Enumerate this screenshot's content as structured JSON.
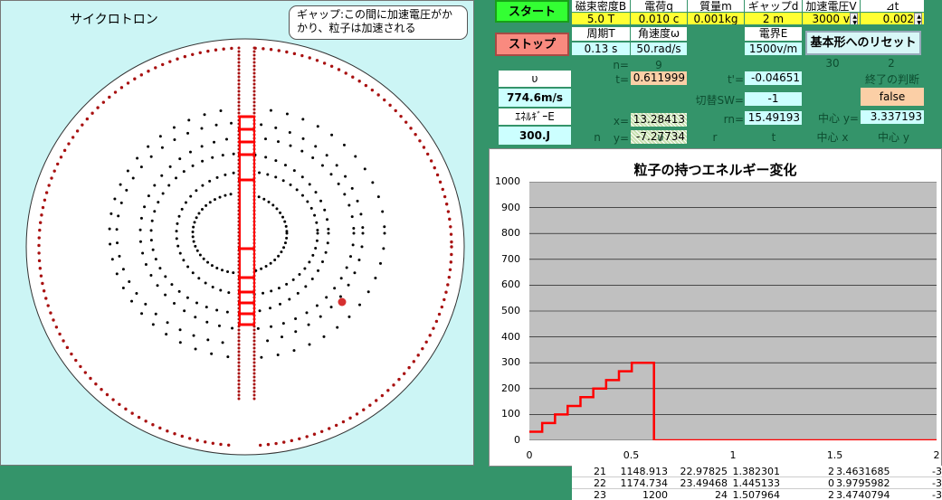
{
  "app": {
    "title": "サイクロトロン",
    "callout": "ギャップ:この間に加速電圧がかかり、粒子は加速される"
  },
  "buttons": {
    "start": "スタート",
    "stop": "ストップ",
    "reset": "基本形へのリセット"
  },
  "params": {
    "headers": [
      "磁束密度B",
      "電荷q",
      "質量m",
      "ギャップd",
      "加速電圧V",
      "⊿t"
    ],
    "values": [
      "5.0 T",
      "0.010 c",
      "0.001kg",
      "2 m",
      "3000 v",
      "0.002"
    ],
    "period_label": "周期T",
    "period_value": "0.13 s",
    "omega_label": "角速度ω",
    "omega_value": "50.rad/s",
    "efield_label": "電界E",
    "efield_value": "1500v/m",
    "extra1": "30",
    "extra2": "2"
  },
  "sim": {
    "v_label": "υ",
    "v_value": "774.6m/s",
    "e_label": "ｴﾈﾙｷﾞｰE",
    "e_value": "300.J",
    "n_label": "n=",
    "n_value": "9",
    "t_label": "t=",
    "t_value": "0.611999",
    "x_label": "x=",
    "x_value": "13.28413",
    "y_label": "y=",
    "y_value": "-7.27734",
    "tp_label": "t'=",
    "tp_value": "-0.04651",
    "sw_label": "切替SW=",
    "sw_value": "-1",
    "rn_label": "rn=",
    "rn_value": "15.49193",
    "end_label": "終了の判断",
    "end_value": "false",
    "cy_label": "中心 y=",
    "cy_value": "3.337193"
  },
  "table": {
    "headers": [
      "n",
      "υ",
      "r",
      "t",
      "中心 x",
      "中心 y"
    ],
    "rows": [
      [
        "21",
        "1148.913",
        "22.97825",
        "1.382301",
        "2",
        "3.4631685",
        "-3"
      ],
      [
        "22",
        "1174.734",
        "23.49468",
        "1.445133",
        "0",
        "3.9795982",
        "-3"
      ],
      [
        "23",
        "1200",
        "24",
        "1.507964",
        "2",
        "3.4740794",
        "-3"
      ]
    ]
  },
  "chart_data": {
    "type": "line",
    "title": "粒子の持つエネルギー変化",
    "xlabel": "",
    "ylabel": "",
    "xlim": [
      0,
      2
    ],
    "ylim": [
      0,
      1000
    ],
    "x_ticks": [
      "0",
      "0.5",
      "1",
      "1.5",
      "2"
    ],
    "y_ticks": [
      "0",
      "100",
      "200",
      "300",
      "400",
      "500",
      "600",
      "700",
      "800",
      "900",
      "1000"
    ],
    "grid": true,
    "legend": "none",
    "series": [
      {
        "color": "#ff0000",
        "x": [
          0,
          0.063,
          0.063,
          0.126,
          0.126,
          0.188,
          0.188,
          0.251,
          0.251,
          0.314,
          0.314,
          0.377,
          0.377,
          0.44,
          0.44,
          0.503,
          0.503,
          0.565,
          0.565,
          0.612,
          0.612,
          2
        ],
        "y": [
          33,
          33,
          67,
          67,
          100,
          100,
          133,
          133,
          167,
          167,
          200,
          200,
          233,
          233,
          267,
          267,
          300,
          300,
          300,
          300,
          0,
          0
        ]
      }
    ]
  }
}
